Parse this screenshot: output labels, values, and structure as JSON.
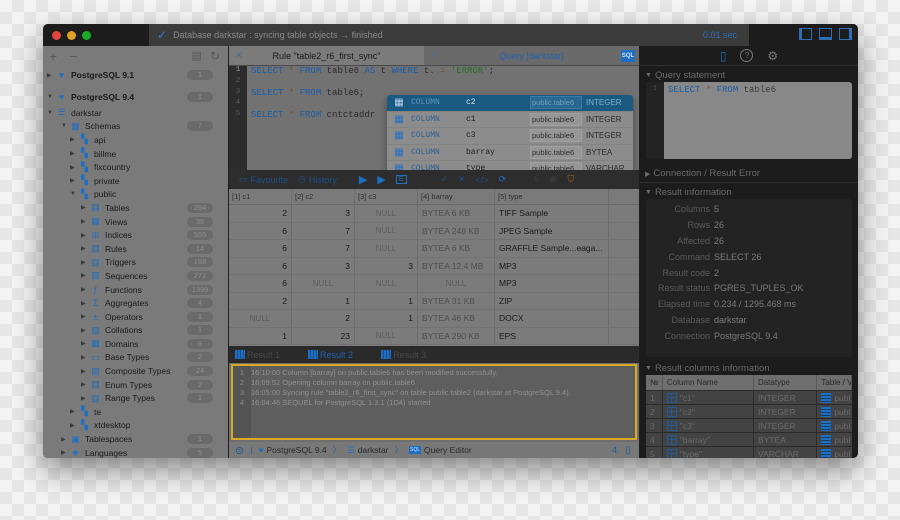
{
  "titlebar": {
    "traffic_lights": [
      {
        "name": "close",
        "color": "#e0443e"
      },
      {
        "name": "minimize",
        "color": "#dea123"
      },
      {
        "name": "zoom",
        "color": "#1aab29"
      }
    ],
    "status_text": "Database darkstar : syncing table objects → finished",
    "elapsed": "0.01 sec",
    "layout_buttons": [
      "toggle-left-panel",
      "toggle-bottom-panel",
      "toggle-right-panel"
    ]
  },
  "sidebar": {
    "toolbar": {
      "add": "+",
      "remove": "−"
    },
    "tree": [
      {
        "label": "PostgreSQL 9.1",
        "level": 0,
        "expanded": false,
        "bold": true,
        "icon": "elephant",
        "badge": "1"
      },
      {
        "label": "PostgreSQL 9.4",
        "level": 0,
        "expanded": true,
        "bold": true,
        "icon": "elephant",
        "badge": "1"
      },
      {
        "label": "darkstar",
        "level": 1,
        "expanded": true,
        "icon": "database",
        "badge": ""
      },
      {
        "label": "Schemas",
        "level": 2,
        "expanded": true,
        "icon": "schemas",
        "badge": "7"
      },
      {
        "label": "api",
        "level": 3,
        "expanded": false,
        "icon": "schema",
        "badge": ""
      },
      {
        "label": "billme",
        "level": 3,
        "expanded": false,
        "icon": "schema",
        "badge": ""
      },
      {
        "label": "fixcountry",
        "level": 3,
        "expanded": false,
        "icon": "schema",
        "badge": ""
      },
      {
        "label": "private",
        "level": 3,
        "expanded": false,
        "icon": "schema",
        "badge": ""
      },
      {
        "label": "public",
        "level": 3,
        "expanded": true,
        "icon": "schema",
        "badge": ""
      },
      {
        "label": "Tables",
        "level": 4,
        "expanded": false,
        "icon": "tables",
        "badge": "294"
      },
      {
        "label": "Views",
        "level": 4,
        "expanded": false,
        "icon": "views",
        "badge": "38"
      },
      {
        "label": "Indices",
        "level": 4,
        "expanded": false,
        "icon": "indices",
        "badge": "555"
      },
      {
        "label": "Rules",
        "level": 4,
        "expanded": false,
        "icon": "rules",
        "badge": "14"
      },
      {
        "label": "Triggers",
        "level": 4,
        "expanded": false,
        "icon": "triggers",
        "badge": "168"
      },
      {
        "label": "Sequences",
        "level": 4,
        "expanded": false,
        "icon": "sequences",
        "badge": "272"
      },
      {
        "label": "Functions",
        "level": 4,
        "expanded": false,
        "icon": "functions",
        "badge": "1399"
      },
      {
        "label": "Aggregates",
        "level": 4,
        "expanded": false,
        "icon": "aggregates",
        "badge": "4"
      },
      {
        "label": "Operators",
        "level": 4,
        "expanded": false,
        "icon": "operators",
        "badge": "1"
      },
      {
        "label": "Collations",
        "level": 4,
        "expanded": false,
        "icon": "collations",
        "badge": "1"
      },
      {
        "label": "Domains",
        "level": 4,
        "expanded": false,
        "icon": "domains",
        "badge": "9"
      },
      {
        "label": "Base Types",
        "level": 4,
        "expanded": false,
        "icon": "base-types",
        "badge": "2"
      },
      {
        "label": "Composite Types",
        "level": 4,
        "expanded": false,
        "icon": "composite-types",
        "badge": "24"
      },
      {
        "label": "Enum Types",
        "level": 4,
        "expanded": false,
        "icon": "enum-types",
        "badge": "2"
      },
      {
        "label": "Range Types",
        "level": 4,
        "expanded": false,
        "icon": "range-types",
        "badge": "1"
      },
      {
        "label": "te",
        "level": 3,
        "expanded": false,
        "icon": "schema",
        "badge": ""
      },
      {
        "label": "xtdesktop",
        "level": 3,
        "expanded": false,
        "icon": "schema",
        "badge": ""
      },
      {
        "label": "Tablespaces",
        "level": 2,
        "expanded": false,
        "icon": "tablespaces",
        "badge": "1"
      },
      {
        "label": "Languages",
        "level": 2,
        "expanded": false,
        "icon": "languages",
        "badge": "5"
      }
    ]
  },
  "editor": {
    "tabs": [
      {
        "label": "Rule \"table2_r6_first_sync\"",
        "active": true
      },
      {
        "label": "Query [darkstar]",
        "active": false
      }
    ],
    "sql_badge": "SQL",
    "line_numbers": [
      "1",
      "2",
      "3",
      "4",
      "5"
    ],
    "lines": [
      "SELECT * FROM table6 AS t WHERE t. = 'ERROR';",
      "",
      "SELECT * FROM table6;",
      "",
      "SELECT * FROM cntctaddr"
    ],
    "autocomplete": [
      {
        "kind": "COLUMN",
        "name": "c2",
        "table": "public.table6",
        "type": "INTEGER",
        "selected": true
      },
      {
        "kind": "COLUMN",
        "name": "c1",
        "table": "public.table6",
        "type": "INTEGER",
        "selected": false
      },
      {
        "kind": "COLUMN",
        "name": "c3",
        "table": "public.table6",
        "type": "INTEGER",
        "selected": false
      },
      {
        "kind": "COLUMN",
        "name": "barray",
        "table": "public.table6",
        "type": "BYTEA",
        "selected": false
      },
      {
        "kind": "COLUMN",
        "name": "type",
        "table": "public.table6",
        "type": "VARCHAR",
        "selected": false
      }
    ]
  },
  "result_toolbar": {
    "favourite": "Favourite",
    "history": "History"
  },
  "grid": {
    "columns": [
      "[1] c1",
      "[2] c2",
      "[3] c3",
      "[4] barray",
      "[5] type"
    ],
    "rows": [
      [
        "2",
        "3",
        "NULL",
        "BYTEA 6 KB",
        "TIFF Sample"
      ],
      [
        "6",
        "7",
        "NULL",
        "BYTEA 248 KB",
        "JPEG Sample"
      ],
      [
        "6",
        "7",
        "NULL",
        "BYTEA 6 KB",
        "GRAFFLE Sample...eaga..."
      ],
      [
        "6",
        "3",
        "3",
        "BYTEA 12.4 MB",
        "MP3"
      ],
      [
        "6",
        "NULL",
        "NULL",
        "NULL",
        "MP3"
      ],
      [
        "2",
        "1",
        "1",
        "BYTEA 31 KB",
        "ZIP"
      ],
      [
        "NULL",
        "2",
        "1",
        "BYTEA 46 KB",
        "DOCX"
      ],
      [
        "1",
        "23",
        "NULL",
        "BYTEA 290 KB",
        "EPS"
      ]
    ]
  },
  "result_tabs": [
    {
      "label": "Result 1",
      "active": false
    },
    {
      "label": "Result 2",
      "active": true
    },
    {
      "label": "Result 3",
      "active": false
    }
  ],
  "log": [
    {
      "n": "1",
      "text": "16:10:00 Column [barray] on public.table6 has been modified successfully."
    },
    {
      "n": "2",
      "text": "16:09:52 Opening column barray on public.table6"
    },
    {
      "n": "3",
      "text": "16:05:00 Syncing rule \"table2_r6_first_sync\" on table public.table2 (darkstar at PostgreSQL 9.4)."
    },
    {
      "n": "4",
      "text": "16:04:46 SEQUEL for PostgreSQL 1.3.1 (1D4) started"
    }
  ],
  "footer": {
    "breadcrumb": [
      "PostgreSQL 9.4",
      "darkstar",
      "Query Editor"
    ],
    "count": "4"
  },
  "inspector": {
    "query_statement": {
      "title": "Query statement",
      "line": "1",
      "code": "SELECT * FROM table6"
    },
    "connection_error_title": "Connection / Result Error",
    "result_info": {
      "title": "Result information",
      "rows": [
        {
          "k": "Columns",
          "v": "5"
        },
        {
          "k": "Rows",
          "v": "26"
        },
        {
          "k": "Affected",
          "v": "26"
        },
        {
          "k": "Command",
          "v": "SELECT 26"
        },
        {
          "k": "Result code",
          "v": "2"
        },
        {
          "k": "Result status",
          "v": "PGRES_TUPLES_OK"
        },
        {
          "k": "Elapsed time",
          "v": "0.234 / 1295.468 ms"
        },
        {
          "k": "Database",
          "v": "darkstar"
        },
        {
          "k": "Connection",
          "v": "PostgreSQL 9.4"
        }
      ]
    },
    "result_columns": {
      "title": "Result columns information",
      "headers": [
        "№",
        "Column Name",
        "Datatype",
        "Table / V"
      ],
      "rows": [
        {
          "n": "1",
          "name": "\"c1\"",
          "type": "INTEGER",
          "table": "publ"
        },
        {
          "n": "2",
          "name": "\"c2\"",
          "type": "INTEGER",
          "table": "publ"
        },
        {
          "n": "3",
          "name": "\"c3\"",
          "type": "INTEGER",
          "table": "publ"
        },
        {
          "n": "4",
          "name": "\"barray\"",
          "type": "BYTEA",
          "table": "publ"
        },
        {
          "n": "5",
          "name": "\"type\"",
          "type": "VARCHAR",
          "table": "publ"
        }
      ]
    }
  }
}
